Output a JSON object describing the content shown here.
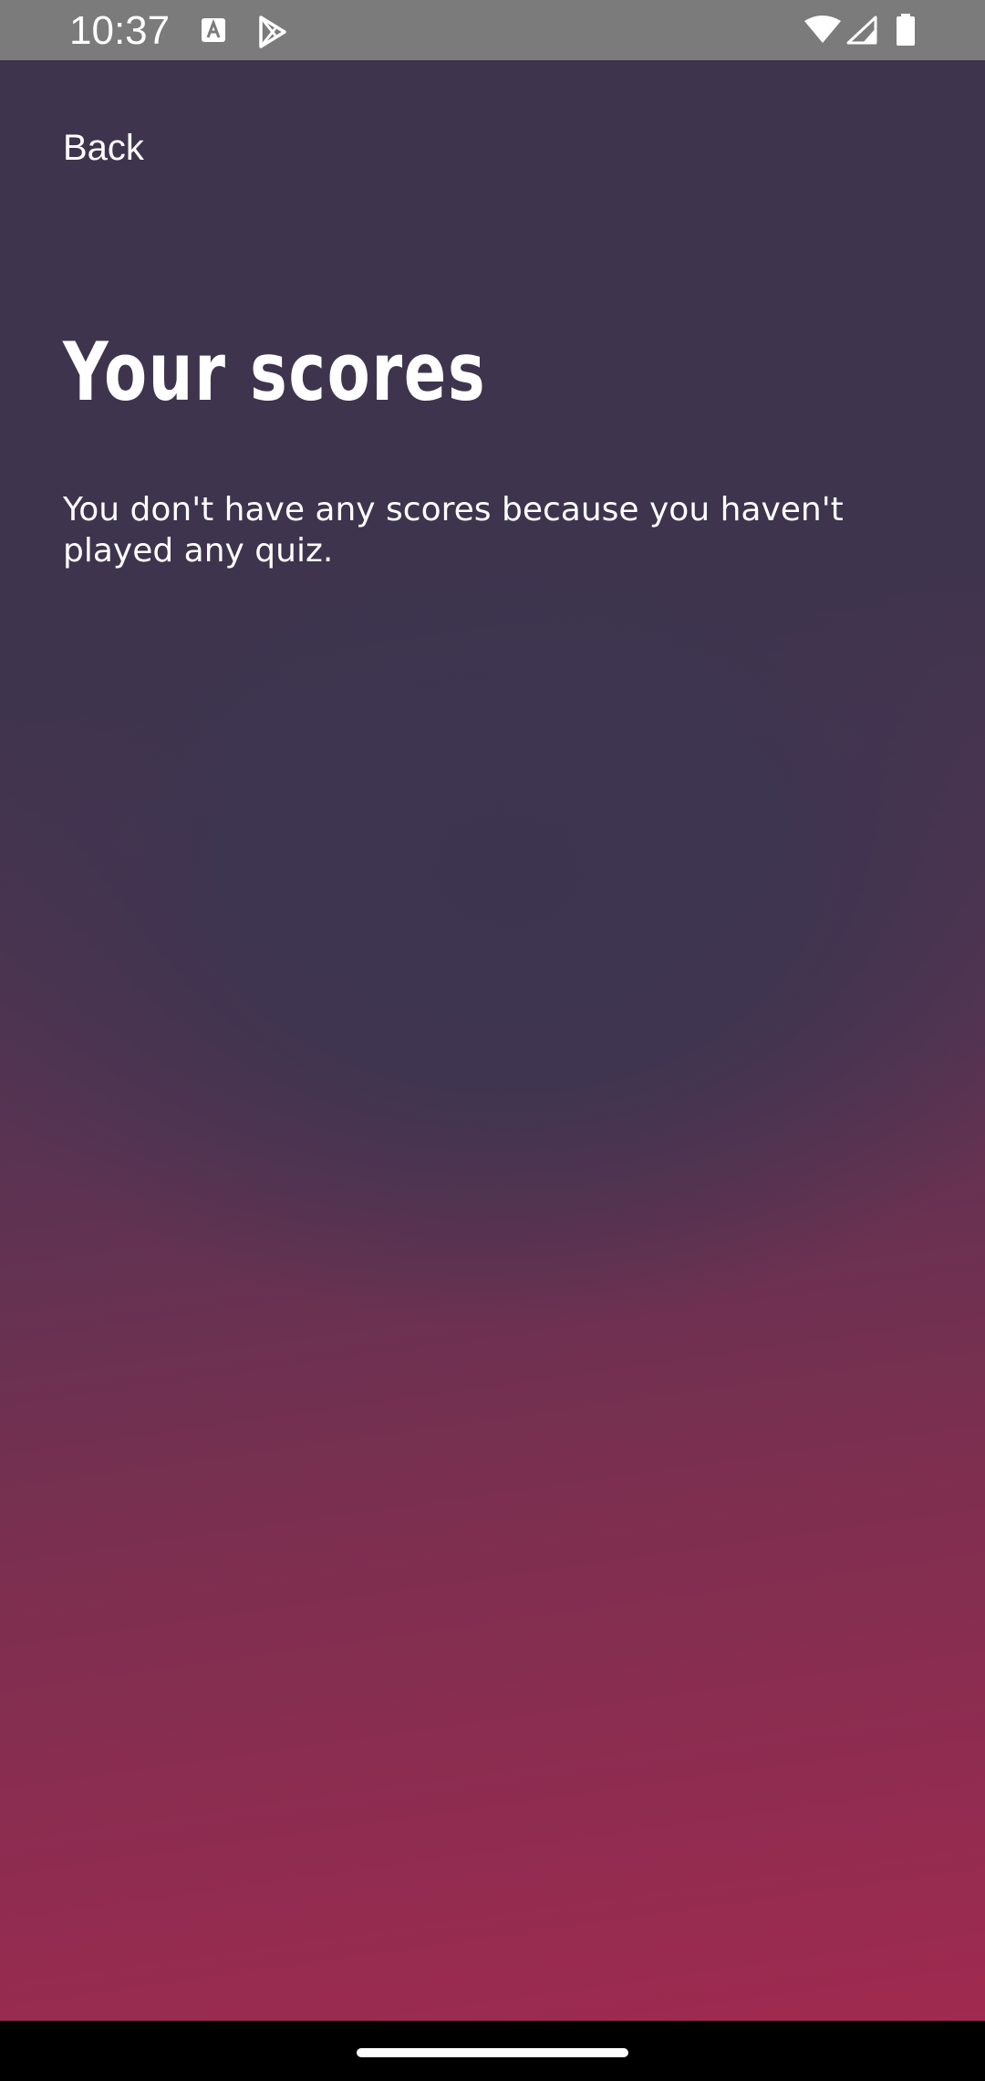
{
  "status_bar": {
    "time": "10:37",
    "icons": [
      "a-text-icon",
      "play-store-icon",
      "wifi-icon",
      "signal-icon",
      "battery-icon"
    ]
  },
  "header": {
    "back_label": "Back"
  },
  "main": {
    "title": "Your scores",
    "empty_message": "You don't have any scores because you haven't played any quiz."
  },
  "colors": {
    "status_bar": "#7b7b7b",
    "gradient_top": "#3e344d",
    "gradient_bottom": "#a02a50",
    "text": "#ffffff",
    "nav_bar": "#000000"
  }
}
